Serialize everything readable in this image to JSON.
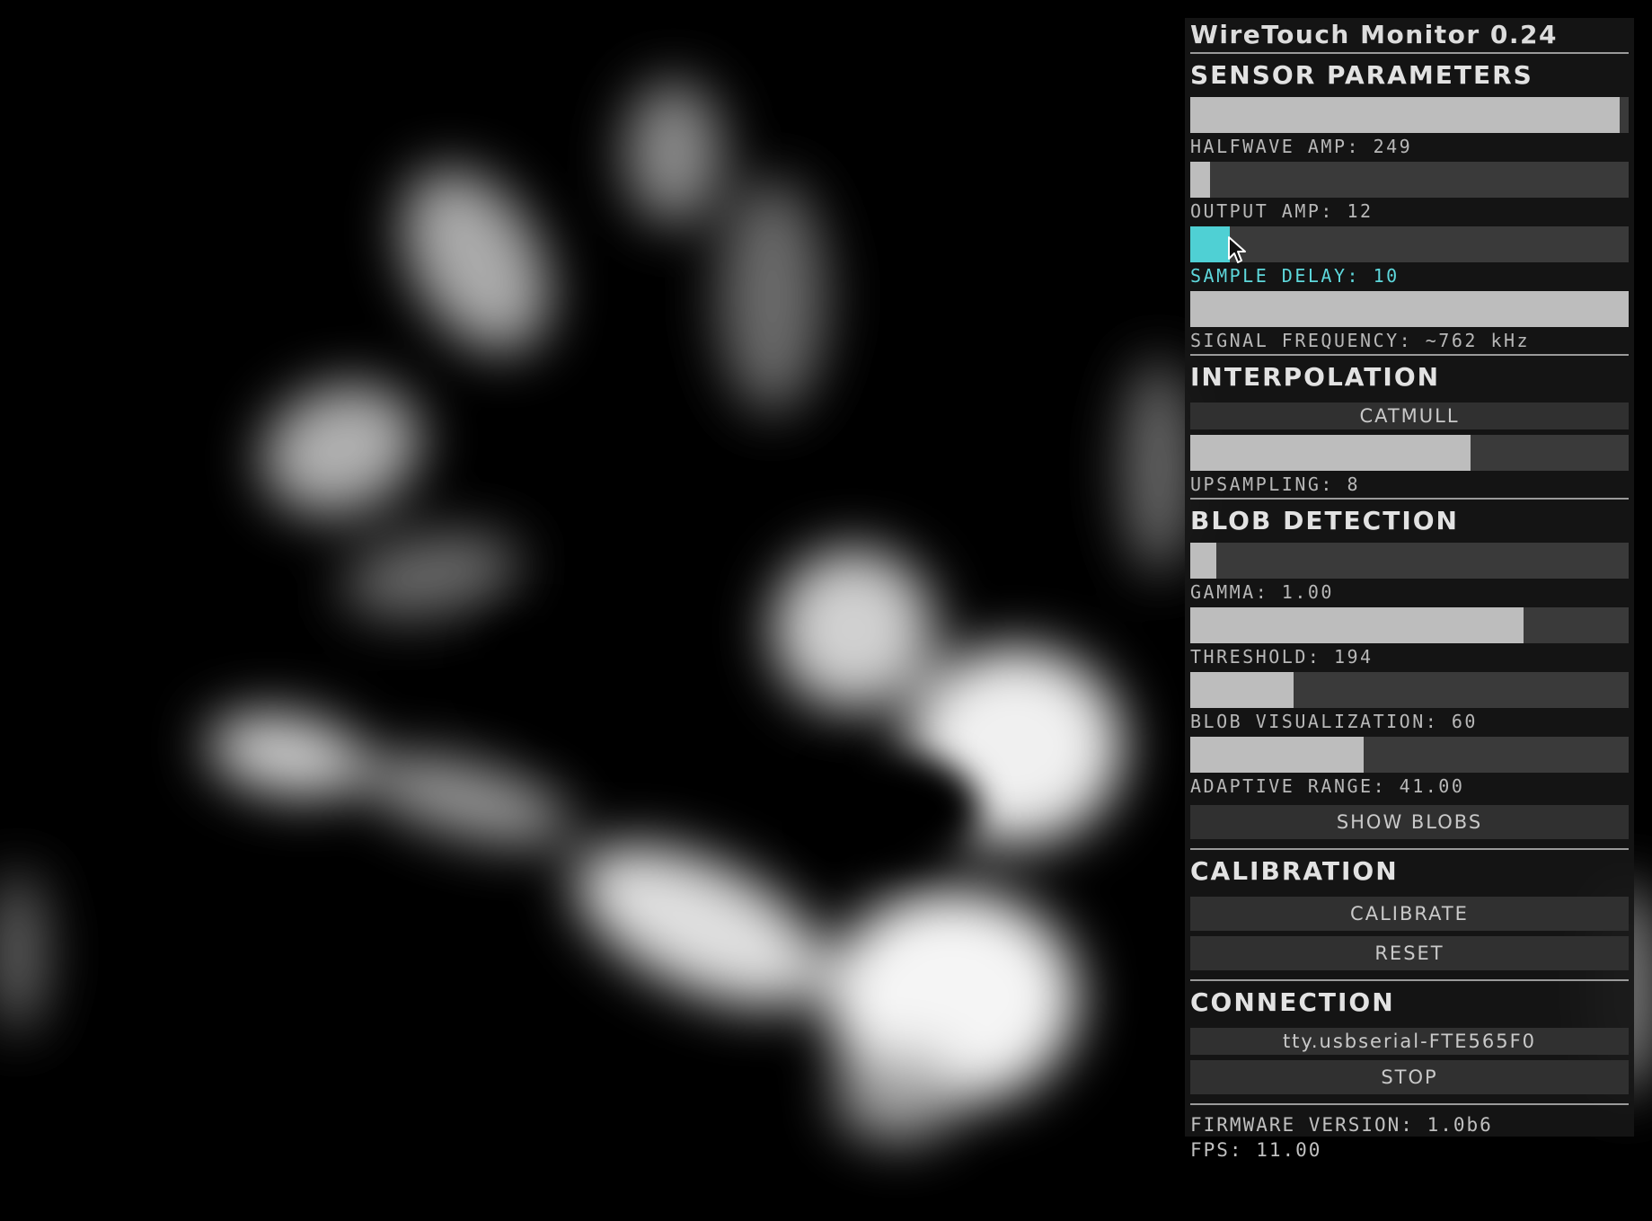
{
  "app": {
    "title": "WireTouch  Monitor  0.24"
  },
  "sensor": {
    "heading": "SENSOR  PARAMETERS",
    "halfwave_amp": {
      "label": "HALFWAVE  AMP:  249",
      "level": 0.98
    },
    "output_amp": {
      "label": "OUTPUT  AMP:  12",
      "level": 0.045
    },
    "sample_delay": {
      "label": "SAMPLE  DELAY:  10",
      "level": 0.09
    },
    "signal_frequency": {
      "label": "SIGNAL  FREQUENCY:  ~762  kHz",
      "level": 1.0
    }
  },
  "interpolation": {
    "heading": "INTERPOLATION",
    "mode_button": "CATMULL",
    "upsampling": {
      "label": "UPSAMPLING:  8",
      "level": 0.64
    }
  },
  "blob": {
    "heading": "BLOB  DETECTION",
    "gamma": {
      "label": "GAMMA:  1.00",
      "level": 0.06
    },
    "threshold": {
      "label": "THRESHOLD:  194",
      "level": 0.76
    },
    "blob_visualization": {
      "label": "BLOB  VISUALIZATION:  60",
      "level": 0.235
    },
    "adaptive_range": {
      "label": "ADAPTIVE  RANGE:  41.00",
      "level": 0.395
    },
    "show_blobs_button": "SHOW  BLOBS"
  },
  "calibration": {
    "heading": "CALIBRATION",
    "calibrate_button": "CALIBRATE",
    "reset_button": "RESET"
  },
  "connection": {
    "heading": "CONNECTION",
    "port": "tty.usbserial-FTE565F0",
    "stop_button": "STOP"
  },
  "status": {
    "firmware": "FIRMWARE  VERSION:  1.0b6",
    "fps": "FPS:  11.00"
  },
  "colors": {
    "accent": "#4fd0d4",
    "slider_fill": "#bdbdbd",
    "slider_track": "#3a3a3a",
    "panel_bg": "#161616"
  }
}
